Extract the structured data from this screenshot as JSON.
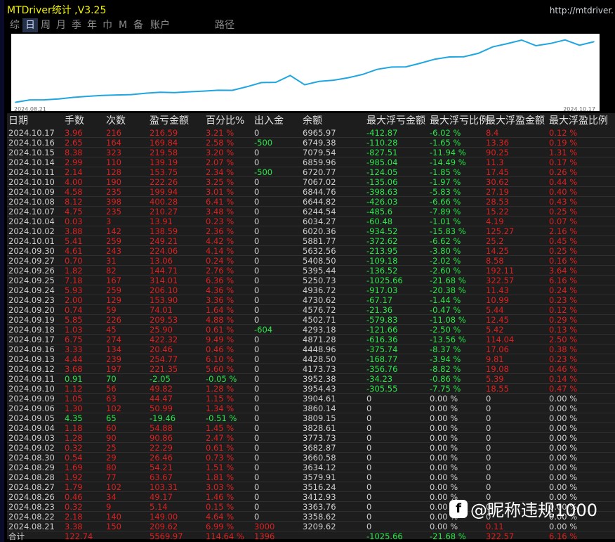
{
  "window": {
    "title": "MTDriver统计  ,V3.25",
    "url": "http://mtdriver."
  },
  "tabs": [
    {
      "label": "综"
    },
    {
      "label": "日"
    },
    {
      "label": "周"
    },
    {
      "label": "月"
    },
    {
      "label": "季"
    },
    {
      "label": "年"
    },
    {
      "label": "巾"
    },
    {
      "label": "M"
    },
    {
      "label": "备"
    },
    {
      "label": "账户"
    },
    {
      "label": "路径"
    }
  ],
  "chart_data": {
    "type": "line",
    "x_start_label": "2024.08.21",
    "x_end_label": "2024.10.17",
    "series": [
      {
        "color": "#1fa6e0",
        "values": [
          3209.62,
          3358.62,
          3363.76,
          3412.93,
          3516.24,
          3579.91,
          3634.12,
          3660.58,
          3682.87,
          3773.73,
          3828.61,
          3809.15,
          3860.14,
          3904.61,
          3954.43,
          3952.38,
          4173.73,
          4428.5,
          4448.96,
          4871.28,
          4293.18,
          4502.71,
          4576.72,
          4730.62,
          4936.72,
          5250.73,
          5395.44,
          5408.5,
          5632.56,
          5881.77,
          6020.36,
          6034.27,
          6244.54,
          6644.82,
          6844.76,
          7067.02,
          6720.77,
          6859.96,
          7079.54,
          6749.38,
          6965.97
        ]
      }
    ]
  },
  "headers": [
    "日期",
    "手数",
    "次数",
    "盈亏金额",
    "百分比%",
    "出入金",
    "余额",
    "最大浮亏金额",
    "最大浮亏比例",
    "最大浮盈金额",
    "最大浮盈比例"
  ],
  "rows": [
    [
      "2024.10.17",
      "3.96",
      "216",
      "216.59",
      "3.21 %",
      "0",
      "6965.97",
      "-412.87",
      "-6.02 %",
      "8.4",
      "0.12 %"
    ],
    [
      "2024.10.16",
      "2.65",
      "164",
      "169.84",
      "2.58 %",
      "-500",
      "6749.38",
      "-110.28",
      "-1.65 %",
      "13.36",
      "0.19 %"
    ],
    [
      "2024.10.15",
      "8.38",
      "323",
      "219.58",
      "3.20 %",
      "0",
      "7079.54",
      "-827.51",
      "-11.94 %",
      "90.25",
      "1.31 %"
    ],
    [
      "2024.10.14",
      "2.99",
      "110",
      "139.19",
      "2.07 %",
      "0",
      "6859.96",
      "-985.04",
      "-14.49 %",
      "11.3",
      "0.17 %"
    ],
    [
      "2024.10.11",
      "2.14",
      "128",
      "153.75",
      "2.34 %",
      "-500",
      "6720.77",
      "-124.05",
      "-1.85 %",
      "17.45",
      "0.26 %"
    ],
    [
      "2024.10.10",
      "4.00",
      "190",
      "222.26",
      "3.25 %",
      "0",
      "7067.02",
      "-135.06",
      "-1.97 %",
      "30.62",
      "0.44 %"
    ],
    [
      "2024.10.09",
      "4.58",
      "235",
      "199.94",
      "3.01 %",
      "0",
      "6844.76",
      "-398.63",
      "-5.83 %",
      "27.19",
      "0.40 %"
    ],
    [
      "2024.10.08",
      "8.12",
      "398",
      "400.28",
      "6.41 %",
      "0",
      "6644.82",
      "-426.03",
      "-6.66 %",
      "28.53",
      "0.43 %"
    ],
    [
      "2024.10.07",
      "4.75",
      "235",
      "210.27",
      "3.48 %",
      "0",
      "6244.54",
      "-485.6",
      "-7.89 %",
      "15.22",
      "0.25 %"
    ],
    [
      "2024.10.04",
      "0.03",
      "3",
      "13.91",
      "0.23 %",
      "0",
      "6034.27",
      "-60.48",
      "-1.01 %",
      "4.19",
      "0.07 %"
    ],
    [
      "2024.10.02",
      "3.88",
      "142",
      "138.59",
      "2.36 %",
      "0",
      "6020.36",
      "-934.52",
      "-15.83 %",
      "125.27",
      "2.16 %"
    ],
    [
      "2024.10.01",
      "5.41",
      "259",
      "249.21",
      "4.42 %",
      "0",
      "5881.77",
      "-372.62",
      "-6.62 %",
      "25.2",
      "0.45 %"
    ],
    [
      "2024.09.30",
      "4.61",
      "243",
      "224.06",
      "4.14 %",
      "0",
      "5632.56",
      "-213.95",
      "-3.80 %",
      "14.25",
      "0.25 %"
    ],
    [
      "2024.09.27",
      "0.70",
      "31",
      "13.06",
      "0.24 %",
      "0",
      "5408.50",
      "-109.18",
      "-2.02 %",
      "8.58",
      "0.16 %"
    ],
    [
      "2024.09.26",
      "1.82",
      "82",
      "144.71",
      "2.76 %",
      "0",
      "5395.44",
      "-136.52",
      "-2.60 %",
      "192.11",
      "3.64 %"
    ],
    [
      "2024.09.25",
      "7.18",
      "167",
      "314.01",
      "6.36 %",
      "0",
      "5250.73",
      "-1025.66",
      "-21.68 %",
      "322.57",
      "6.16 %"
    ],
    [
      "2024.09.24",
      "5.93",
      "259",
      "206.10",
      "4.36 %",
      "0",
      "4936.72",
      "-917.03",
      "-20.38 %",
      "11.43",
      "0.24 %"
    ],
    [
      "2024.09.23",
      "2.00",
      "129",
      "153.90",
      "3.36 %",
      "0",
      "4730.62",
      "-67.17",
      "-1.44 %",
      "10.99",
      "0.23 %"
    ],
    [
      "2024.09.20",
      "0.74",
      "59",
      "74.01",
      "1.64 %",
      "0",
      "4576.72",
      "-21.36",
      "-0.47 %",
      "5.44",
      "0.12 %"
    ],
    [
      "2024.09.19",
      "5.85",
      "226",
      "209.53",
      "4.88 %",
      "0",
      "4502.71",
      "-579.83",
      "-11.08 %",
      "12.45",
      "0.29 %"
    ],
    [
      "2024.09.18",
      "1.03",
      "45",
      "25.90",
      "0.61 %",
      "-604",
      "4293.18",
      "-121.66",
      "-2.50 %",
      "5.42",
      "0.13 %"
    ],
    [
      "2024.09.17",
      "6.75",
      "274",
      "422.32",
      "9.49 %",
      "0",
      "4871.28",
      "-616.36",
      "-13.56 %",
      "114.04",
      "2.50 %"
    ],
    [
      "2024.09.16",
      "3.33",
      "134",
      "20.46",
      "0.46 %",
      "0",
      "4448.96",
      "-375.74",
      "-8.37 %",
      "17.06",
      "0.38 %"
    ],
    [
      "2024.09.13",
      "4.44",
      "239",
      "254.77",
      "6.10 %",
      "0",
      "4428.50",
      "-168.77",
      "-3.94 %",
      "9.81",
      "0.23 %"
    ],
    [
      "2024.09.12",
      "3.68",
      "197",
      "221.35",
      "5.60 %",
      "0",
      "4173.73",
      "-356.76",
      "-8.82 %",
      "19.08",
      "0.46 %"
    ],
    [
      "2024.09.11",
      "0.91",
      "70",
      "-2.05",
      "-0.05 %",
      "0",
      "3952.38",
      "-34.23",
      "-0.86 %",
      "5.39",
      "0.14 %"
    ],
    [
      "2024.09.10",
      "1.12",
      "56",
      "49.82",
      "1.28 %",
      "0",
      "3954.43",
      "-305.55",
      "-7.75 %",
      "18.55",
      "0.47 %"
    ],
    [
      "2024.09.09",
      "1.05",
      "63",
      "44.47",
      "1.15 %",
      "0",
      "3904.61",
      "0",
      "0.00 %",
      "0",
      "0.00 %"
    ],
    [
      "2024.09.06",
      "1.30",
      "102",
      "50.99",
      "1.34 %",
      "0",
      "3860.14",
      "0",
      "0.00 %",
      "0",
      "0.00 %"
    ],
    [
      "2024.09.05",
      "4.35",
      "65",
      "-19.46",
      "-0.51 %",
      "0",
      "3809.15",
      "0",
      "0.00 %",
      "0",
      "0.00 %"
    ],
    [
      "2024.09.04",
      "1.18",
      "60",
      "54.88",
      "1.45 %",
      "0",
      "3828.61",
      "0",
      "0.00 %",
      "0",
      "0.00 %"
    ],
    [
      "2024.09.03",
      "1.28",
      "90",
      "90.86",
      "2.47 %",
      "0",
      "3773.73",
      "0",
      "0.00 %",
      "0",
      "0.00 %"
    ],
    [
      "2024.09.02",
      "0.32",
      "25",
      "22.29",
      "0.61 %",
      "0",
      "3682.87",
      "0",
      "0.00 %",
      "0",
      "0.00 %"
    ],
    [
      "2024.08.30",
      "0.54",
      "29",
      "26.46",
      "0.73 %",
      "0",
      "3660.58",
      "0",
      "0.00 %",
      "0",
      "0.00 %"
    ],
    [
      "2024.08.29",
      "1.69",
      "80",
      "54.21",
      "1.51 %",
      "0",
      "3634.12",
      "0",
      "0.00 %",
      "0",
      "0.00 %"
    ],
    [
      "2024.08.28",
      "1.92",
      "77",
      "63.67",
      "1.81 %",
      "0",
      "3579.91",
      "0",
      "0.00 %",
      "0",
      "0.00 %"
    ],
    [
      "2024.08.27",
      "1.79",
      "102",
      "103.31",
      "3.03 %",
      "0",
      "3516.24",
      "0",
      "0.00 %",
      "0",
      "0.00 %"
    ],
    [
      "2024.08.26",
      "0.46",
      "34",
      "49.17",
      "1.46 %",
      "0",
      "3412.93",
      "0",
      "0.00 %",
      "0",
      "0.00 %"
    ],
    [
      "2024.08.23",
      "0.32",
      "9",
      "5.14",
      "0.15 %",
      "0",
      "3363.76",
      "0",
      "0.00 %",
      "0",
      "0.00 %"
    ],
    [
      "2024.08.22",
      "2.18",
      "140",
      "149.00",
      "4.64 %",
      "0",
      "3358.62",
      "0",
      "0.00 %",
      "0",
      "0.00 %"
    ],
    [
      "2024.08.21",
      "3.38",
      "150",
      "209.62",
      "6.99 %",
      "3000",
      "3209.62",
      "0",
      "0.00 %",
      "0.11",
      "0.00 %"
    ]
  ],
  "total": [
    "合计",
    "122.74",
    "",
    "5569.97",
    "114.64 %",
    "1396",
    "",
    "-1025.66",
    "-21.68 %",
    "322.57",
    "6.16 %"
  ],
  "colors": {
    "red": "#e02020",
    "green": "#29e84a",
    "neutral": "#cfcfcf",
    "title": "#f2f200",
    "line": "#1fa6e0"
  },
  "watermark": {
    "text": "@昵称违规1000",
    "logo": "f"
  }
}
